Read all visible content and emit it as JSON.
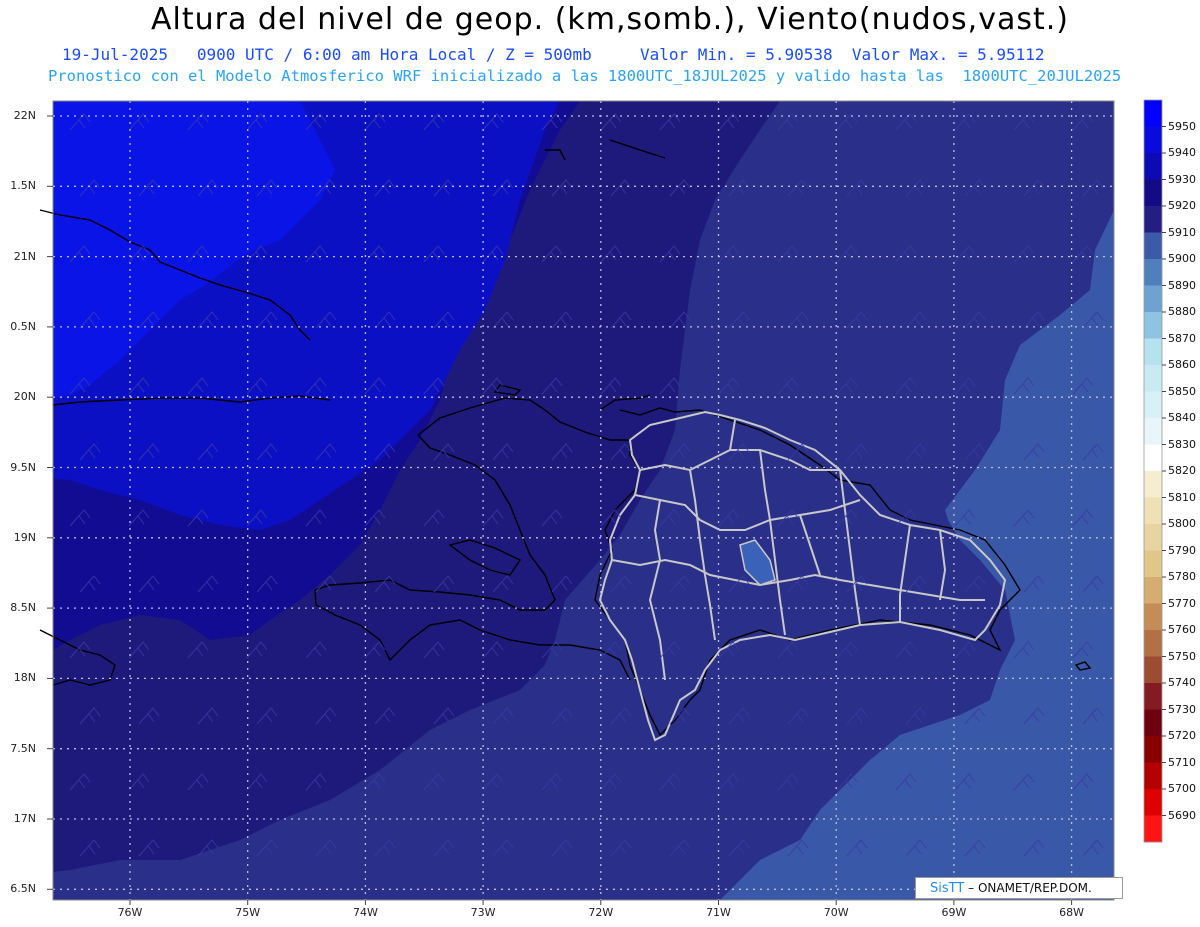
{
  "header": {
    "title": "Altura del nivel de geop. (km,somb.), Viento(nudos,vast.)",
    "subtitle_line1": "19-Jul-2025   0900 UTC / 6:00 am Hora Local / Z = 500mb     Valor Min. = 5.90538  Valor Max. = 5.95112",
    "subtitle_line2": "Pronostico con el Modelo Atmosferico WRF inicializado a las 1800UTC_18JUL2025 y valido hasta las  1800UTC_20JUL2025"
  },
  "map": {
    "lat_labels": [
      "22N",
      "1.5N",
      "21N",
      "0.5N",
      "20N",
      "9.5N",
      "19N",
      "8.5N",
      "18N",
      "7.5N",
      "17N",
      "6.5N"
    ],
    "lon_labels": [
      "76W",
      "75W",
      "74W",
      "73W",
      "72W",
      "71W",
      "70W",
      "69W",
      "68W"
    ],
    "fill_colors": {
      "band_5950": "#0a14e6",
      "band_5940": "#0c10c4",
      "band_5930": "#120c92",
      "band_5920": "#1e1a7c",
      "band_5910": "#2a2f8a",
      "band_5900": "#3a58a8"
    }
  },
  "colorbar": {
    "levels": [
      "5950",
      "5940",
      "5930",
      "5920",
      "5910",
      "5900",
      "5890",
      "5880",
      "5870",
      "5860",
      "5850",
      "5840",
      "5830",
      "5820",
      "5810",
      "5800",
      "5790",
      "5780",
      "5770",
      "5760",
      "5750",
      "5740",
      "5730",
      "5720",
      "5710",
      "5700",
      "5690"
    ],
    "colors": [
      "#0000ff",
      "#0a0adc",
      "#0c0ab4",
      "#130a86",
      "#251e82",
      "#3b5aa8",
      "#4f80bd",
      "#6ea2d0",
      "#8ec3e2",
      "#b6e1ee",
      "#c9eaf3",
      "#d8f0f7",
      "#e7f6fa",
      "#ffffff",
      "#f6eccf",
      "#efe0b6",
      "#e8d4a1",
      "#e1c68a",
      "#d5ad71",
      "#c48d58",
      "#b37044",
      "#9c4c33",
      "#851b22",
      "#6e0010",
      "#880000",
      "#b30000",
      "#de0000",
      "#ff1414"
    ]
  },
  "credit": {
    "logo_text": "SisTT",
    "text": "– ONAMET/REP.DOM."
  }
}
